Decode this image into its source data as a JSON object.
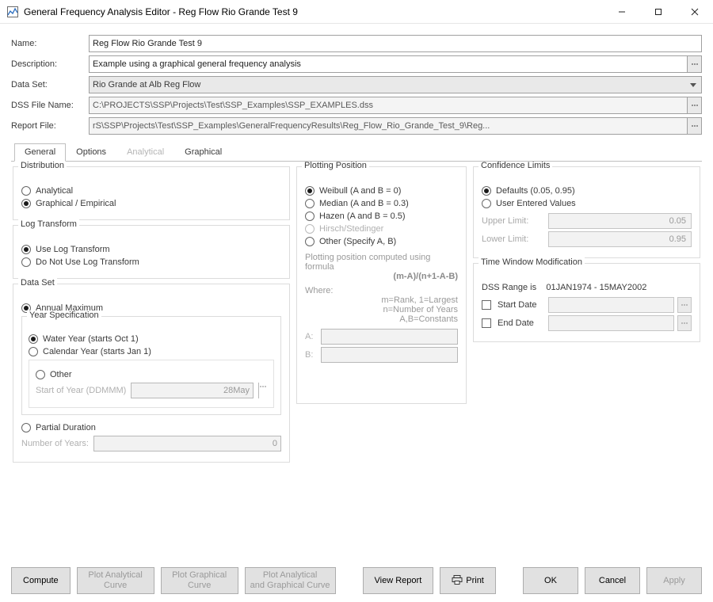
{
  "window": {
    "title": "General Frequency Analysis Editor - Reg Flow Rio Grande Test 9"
  },
  "header": {
    "name_label": "Name:",
    "name_value": "Reg Flow Rio Grande Test 9",
    "desc_label": "Description:",
    "desc_value": "Example using a graphical general frequency analysis",
    "dataset_label": "Data Set:",
    "dataset_value": "Rio Grande at Alb Reg Flow",
    "dssfile_label": "DSS File Name:",
    "dssfile_value": "C:\\PROJECTS\\SSP\\Projects\\Test\\SSP_Examples\\SSP_EXAMPLES.dss",
    "report_label": "Report File:",
    "report_value": "rS\\SSP\\Projects\\Test\\SSP_Examples\\GeneralFrequencyResults\\Reg_Flow_Rio_Grande_Test_9\\Reg..."
  },
  "tabs": {
    "general": "General",
    "options": "Options",
    "analytical": "Analytical",
    "graphical": "Graphical"
  },
  "distribution": {
    "legend": "Distribution",
    "analytical": "Analytical",
    "graphical": "Graphical / Empirical"
  },
  "logtransform": {
    "legend": "Log Transform",
    "use": "Use Log Transform",
    "donot": "Do Not Use Log Transform"
  },
  "dataset_group": {
    "legend": "Data Set",
    "annual_max": "Annual Maximum",
    "year_spec_legend": "Year Specification",
    "water_year": "Water Year (starts Oct 1)",
    "calendar_year": "Calendar Year (starts Jan 1)",
    "other": "Other",
    "start_of_year_label": "Start of Year (DDMMM)",
    "start_of_year_value": "28May",
    "partial": "Partial Duration",
    "num_years_label": "Number of Years:",
    "num_years_value": "0"
  },
  "plotting": {
    "legend": "Plotting Position",
    "weibull": "Weibull (A and B = 0)",
    "median": "Median (A and B = 0.3)",
    "hazen": "Hazen (A and B = 0.5)",
    "hirsch": "Hirsch/Stedinger",
    "other": "Other (Specify A, B)",
    "note_line1": "Plotting position computed using formula",
    "formula": "(m-A)/(n+1-A-B)",
    "where": "Where:",
    "def1": "m=Rank, 1=Largest",
    "def2": "n=Number of Years",
    "def3": "A,B=Constants",
    "a_label": "A:",
    "b_label": "B:"
  },
  "confidence": {
    "legend": "Confidence Limits",
    "defaults": "Defaults (0.05, 0.95)",
    "user": "User Entered Values",
    "upper_label": "Upper Limit:",
    "upper_value": "0.05",
    "lower_label": "Lower Limit:",
    "lower_value": "0.95"
  },
  "timewindow": {
    "legend": "Time Window Modification",
    "range_label": "DSS Range is",
    "range_value": "01JAN1974 - 15MAY2002",
    "start_date": "Start Date",
    "end_date": "End Date"
  },
  "buttons": {
    "compute": "Compute",
    "plot_analytical": "Plot Analytical\nCurve",
    "plot_graphical": "Plot Graphical\nCurve",
    "plot_both": "Plot Analytical\nand Graphical Curve",
    "view_report": "View Report",
    "print": "Print",
    "ok": "OK",
    "cancel": "Cancel",
    "apply": "Apply"
  }
}
